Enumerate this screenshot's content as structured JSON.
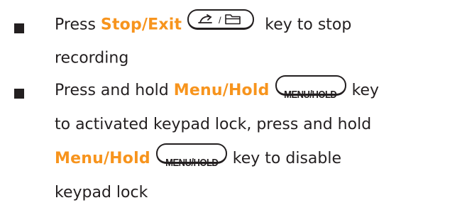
{
  "bullets": [
    {
      "press_word": "Press",
      "key_name": "Stop/Exit",
      "key_icons": [
        "back-arrow-icon",
        "folder-icon"
      ],
      "key_separator": "/",
      "suffix_line1": "key to stop",
      "line2": "recording"
    },
    {
      "line1_prefix": "Press and hold",
      "key_name": "Menu/Hold",
      "key_cap_label": "MENU/HOLD",
      "line1_suffix": "key",
      "line2": "to activated keypad lock, press and hold",
      "line3_key_name": "Menu/Hold",
      "line3_key_cap_label": "MENU/HOLD",
      "line3_suffix": "key to disable",
      "line4": "keypad lock"
    }
  ],
  "colors": {
    "text": "#231f20",
    "key_name": "#f7941d",
    "bullet": "#231f20"
  }
}
